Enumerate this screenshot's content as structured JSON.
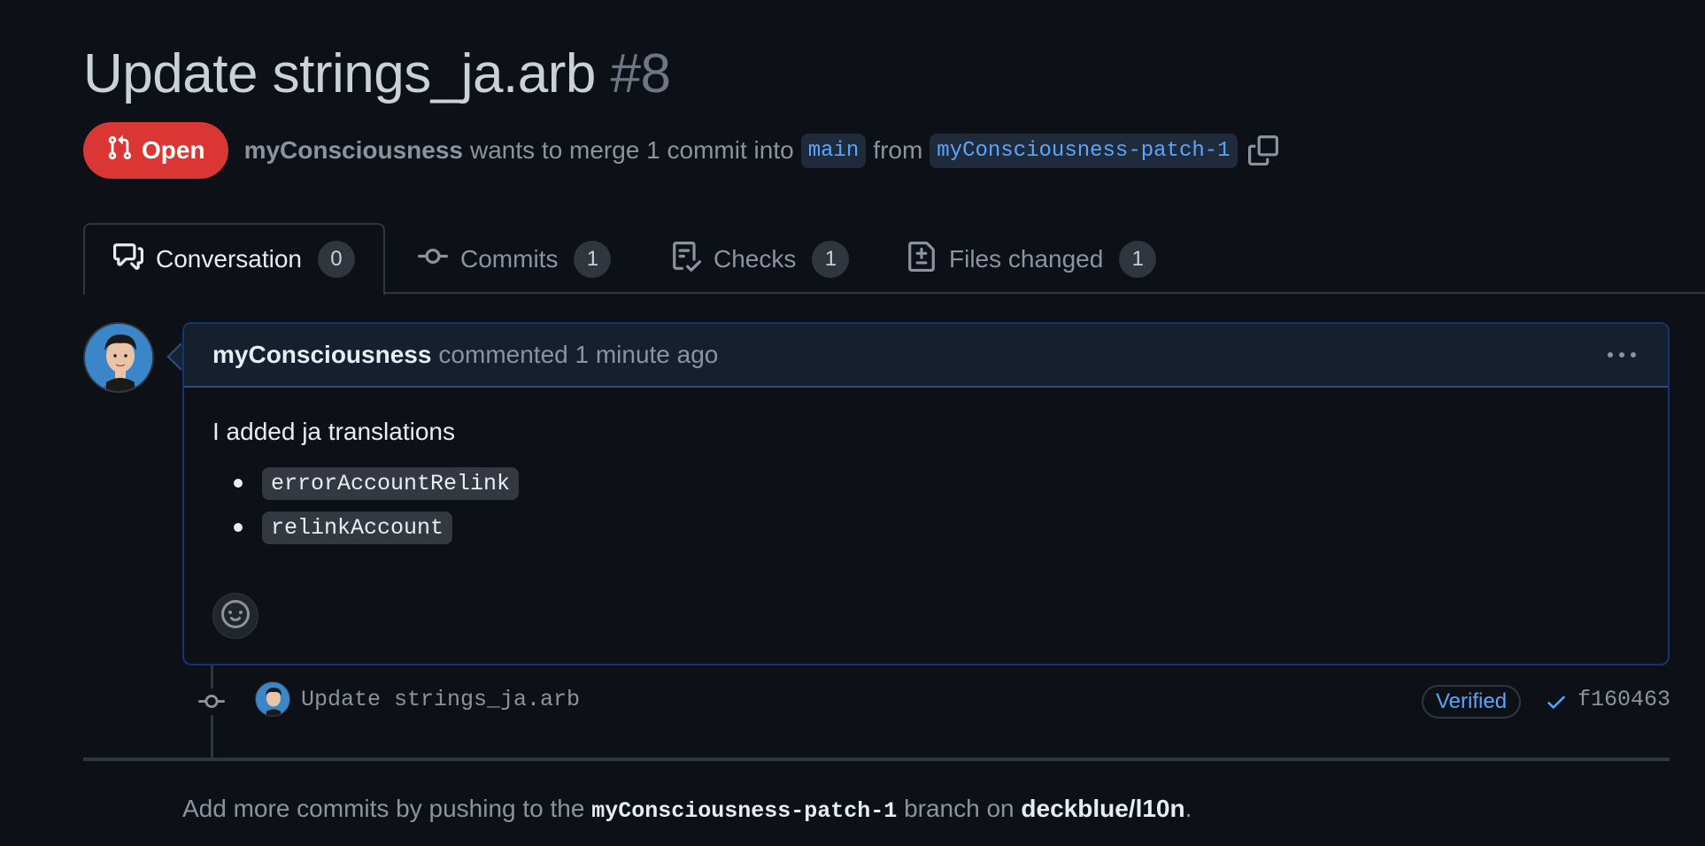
{
  "pr": {
    "title": "Update strings_ja.arb",
    "number": "#8",
    "state": "Open",
    "author": "myConsciousness",
    "merge_text": "wants to merge 1 commit into",
    "base_branch": "main",
    "from_text": "from",
    "head_branch": "myConsciousness-patch-1"
  },
  "tabs": [
    {
      "label": "Conversation",
      "count": "0"
    },
    {
      "label": "Commits",
      "count": "1"
    },
    {
      "label": "Checks",
      "count": "1"
    },
    {
      "label": "Files changed",
      "count": "1"
    }
  ],
  "comment": {
    "author": "myConsciousness",
    "action": "commented 1 minute ago",
    "body": "I added ja translations",
    "items": [
      "errorAccountRelink",
      "relinkAccount"
    ]
  },
  "commit": {
    "message": "Update strings_ja.arb",
    "verified": "Verified",
    "sha": "f160463"
  },
  "footer": {
    "prefix": "Add more commits by pushing to the",
    "branch": "myConsciousness-patch-1",
    "middle": "branch on",
    "repo": "deckblue/l10n",
    "suffix": "."
  },
  "colors": {
    "background": "#0d1117",
    "open_badge": "#da3633",
    "link": "#58a6ff"
  }
}
